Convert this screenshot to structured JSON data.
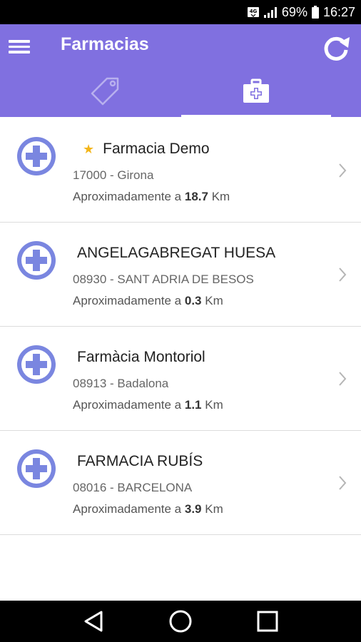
{
  "status_bar": {
    "network": "4G",
    "battery": "69%",
    "time": "16:27"
  },
  "app_bar": {
    "title": "Farmacias",
    "tabs": [
      {
        "icon": "tag-icon",
        "active": false
      },
      {
        "icon": "first-aid-kit-icon",
        "active": true
      }
    ]
  },
  "pharmacies": [
    {
      "name": "Farmacia Demo",
      "starred": true,
      "address": "17000 - Girona",
      "distance_prefix": "Aproximadamente a",
      "distance": "18.7",
      "unit": "Km"
    },
    {
      "name": "ANGELAGABREGAT HUESA",
      "starred": false,
      "address": "08930 - SANT ADRIA DE BESOS",
      "distance_prefix": "Aproximadamente a",
      "distance": "0.3",
      "unit": "Km"
    },
    {
      "name": "Farmàcia Montoriol",
      "starred": false,
      "address": "08913 - Badalona",
      "distance_prefix": "Aproximadamente a",
      "distance": "1.1",
      "unit": "Km"
    },
    {
      "name": "FARMACIA RUBÍS",
      "starred": false,
      "address": "08016 - BARCELONA",
      "distance_prefix": "Aproximadamente a",
      "distance": "3.9",
      "unit": "Km"
    }
  ],
  "colors": {
    "primary": "#8070e0",
    "icon": "#7a86e0",
    "star": "#f3b519"
  }
}
